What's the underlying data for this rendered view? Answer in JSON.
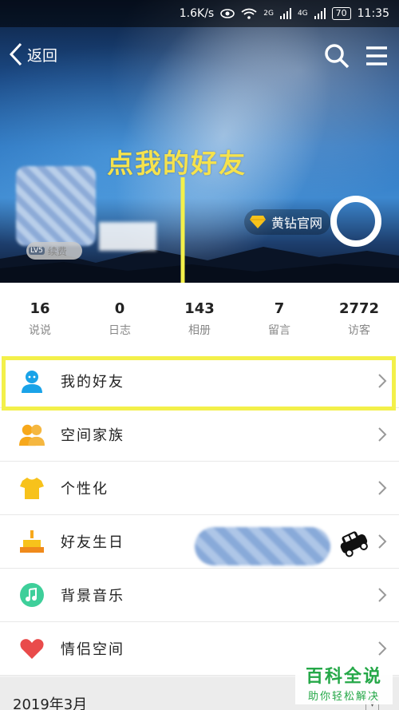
{
  "status_bar": {
    "speed": "1.6K/s",
    "net1": "2G",
    "net2": "4G",
    "battery": "70",
    "time": "11:35"
  },
  "nav": {
    "back_label": "返回"
  },
  "annotation": {
    "title": "点我的好友"
  },
  "profile": {
    "level_tag": "LV5",
    "renew_label": "续费",
    "vip_label": "黄钻官网"
  },
  "stats": [
    {
      "num": "16",
      "label": "说说"
    },
    {
      "num": "0",
      "label": "日志"
    },
    {
      "num": "143",
      "label": "相册"
    },
    {
      "num": "7",
      "label": "留言"
    },
    {
      "num": "2772",
      "label": "访客"
    }
  ],
  "menu": [
    {
      "label": "我的好友",
      "icon": "person-icon"
    },
    {
      "label": "空间家族",
      "icon": "group-icon"
    },
    {
      "label": "个性化",
      "icon": "tshirt-icon"
    },
    {
      "label": "好友生日",
      "icon": "cake-icon"
    },
    {
      "label": "背景音乐",
      "icon": "music-icon"
    },
    {
      "label": "情侣空间",
      "icon": "heart-icon"
    }
  ],
  "feed": {
    "date": "2019年3月"
  },
  "watermark": {
    "line1": "百科全说",
    "line2": "助你轻松解决"
  },
  "colors": {
    "highlight": "#f3f04a",
    "brand_green": "#25a848",
    "friend_blue": "#1aa3e8",
    "orange": "#f7a81b"
  }
}
